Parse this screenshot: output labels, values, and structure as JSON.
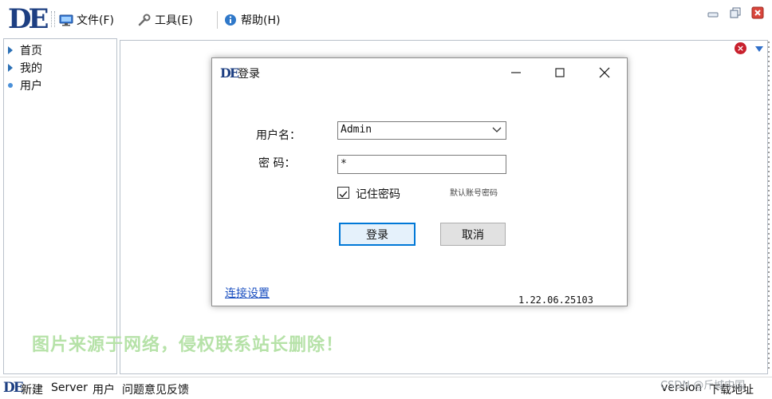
{
  "app": {
    "logo_text": "DE",
    "menu": [
      {
        "label": "文件(F)",
        "icon": "monitor-icon"
      },
      {
        "label": "工具(E)",
        "icon": "wrench-icon"
      },
      {
        "label": "帮助(H)",
        "icon": "info-icon"
      }
    ],
    "window_controls": [
      "minimize-icon",
      "restore-icon",
      "close-icon"
    ]
  },
  "sidebar": {
    "items": [
      {
        "label": "首页",
        "icon": "arrow-right-icon"
      },
      {
        "label": "我的",
        "icon": "arrow-right-icon"
      },
      {
        "label": "用户",
        "icon": "dot-icon"
      }
    ]
  },
  "main": {
    "close_icon": "×",
    "watermark": "图片来源于网络，侵权联系站长删除！"
  },
  "dialog": {
    "title": "登录",
    "logo_text": "DE",
    "username_label": "用户名：",
    "username_value": "Admin",
    "password_label": "密  码：",
    "password_value": "*",
    "remember_label": "记住密码",
    "remember_checked": true,
    "default_hint": "默认账号密码",
    "login_button": "登录",
    "cancel_button": "取消",
    "connection_link": "连接设置",
    "version": "1.22.06.25103"
  },
  "statusbar": {
    "logo_text": "DE",
    "items": [
      "新建",
      "Server",
      "用户",
      "问题意见反馈"
    ],
    "right_items": [
      "version",
      "下载地址"
    ],
    "csdn_watermark": "CSDN @斤城中国"
  },
  "colors": {
    "brand": "#1d3f82",
    "primary_border": "#0078d7",
    "link": "#1a4fc0",
    "close_red": "#c8202d"
  }
}
